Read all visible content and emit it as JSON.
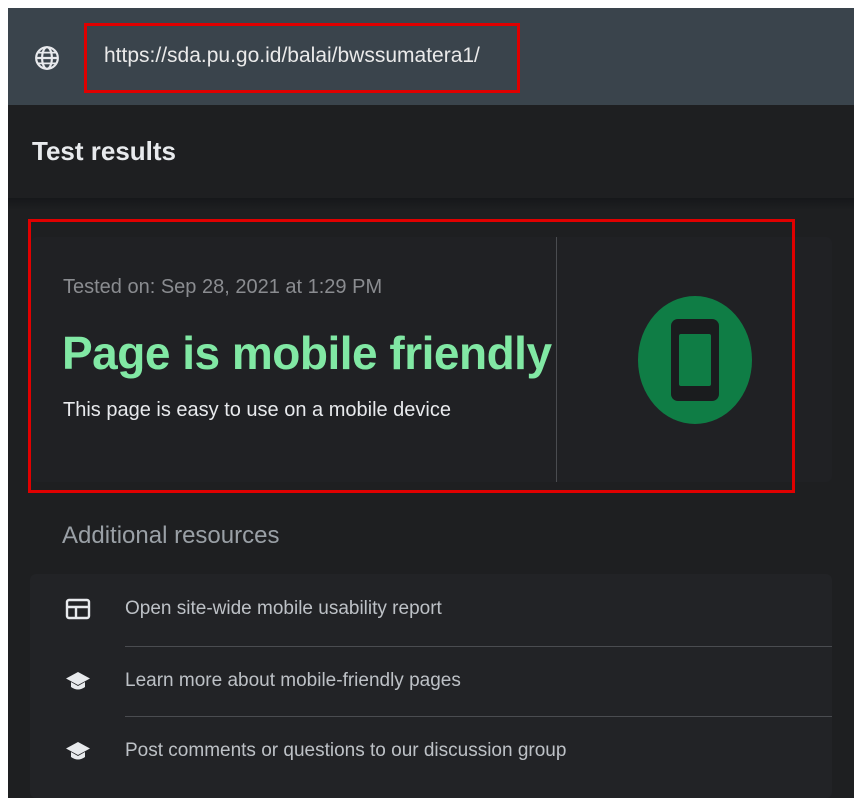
{
  "url_bar": {
    "url": "https://sda.pu.go.id/balai/bwssumatera1/",
    "icon": "globe-icon"
  },
  "section": {
    "title": "Test results"
  },
  "result": {
    "tested_on": "Tested on: Sep 28, 2021 at 1:29 PM",
    "title": "Page is mobile friendly",
    "subtitle": "This page is easy to use on a mobile device",
    "icon": "smartphone-icon",
    "accent_color": "#81e8a4",
    "icon_color": "#0f7d45"
  },
  "resources": {
    "header": "Additional resources",
    "items": [
      {
        "label": "Open site-wide mobile usability report",
        "icon": "report-icon"
      },
      {
        "label": "Learn more about mobile-friendly pages",
        "icon": "school-icon"
      },
      {
        "label": "Post comments or questions to our discussion group",
        "icon": "school-icon"
      }
    ]
  },
  "highlight_color": "#e00000"
}
